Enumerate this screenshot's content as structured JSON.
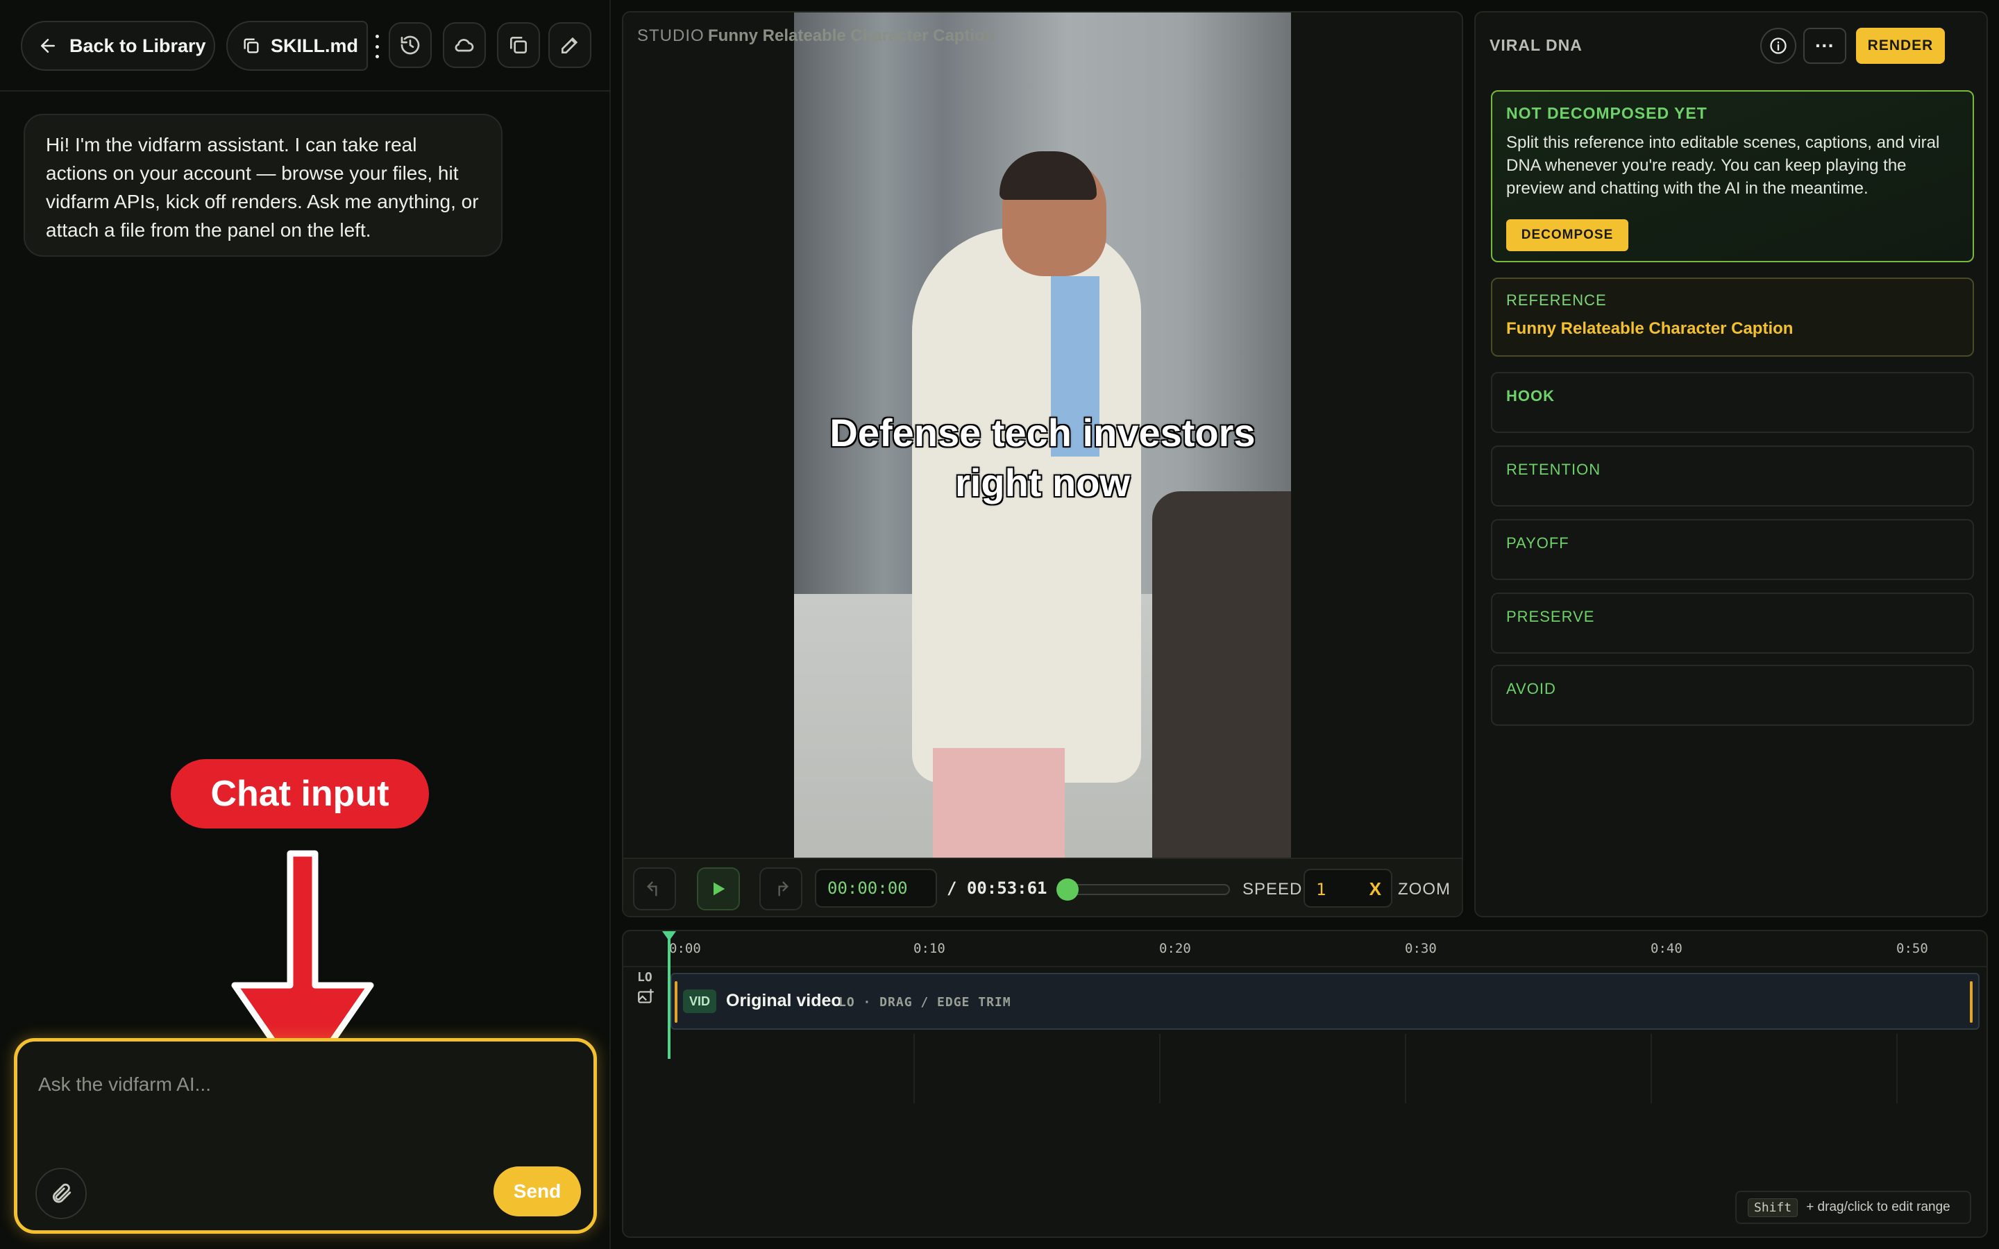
{
  "topbar": {
    "back_label": "Back to Library",
    "skill_label": "SKILL.md"
  },
  "chat": {
    "assistant_message": "Hi! I'm the vidfarm assistant. I can take real actions on your account — browse your files, hit vidfarm APIs, kick off renders. Ask me anything, or attach a file from the panel on the left.",
    "input_placeholder": "Ask the vidfarm AI...",
    "send_label": "Send"
  },
  "annotation": {
    "label": "Chat input",
    "color": "#e4202a"
  },
  "preview": {
    "studio_label": "STUDIO",
    "title": "Funny Relateable Character Caption",
    "caption_line1": "Defense tech investors",
    "caption_line2": "right now",
    "time_current": "00:00:00",
    "time_separator": "/",
    "time_total": "00:53:61",
    "speed_label": "SPEED",
    "speed_value": "1",
    "speed_suffix": "X",
    "zoom_label": "ZOOM",
    "scrub_position": 0
  },
  "viral_dna": {
    "title": "VIRAL DNA",
    "render_label": "RENDER",
    "more_label": "···",
    "not_decomposed": {
      "title": "NOT DECOMPOSED YET",
      "body": "Split this reference into editable scenes, captions, and viral DNA whenever you're ready. You can keep playing the preview and chatting with the AI in the meantime.",
      "button": "DECOMPOSE"
    },
    "reference": {
      "label": "REFERENCE",
      "title": "Funny Relateable Character Caption"
    },
    "sections": [
      "HOOK",
      "RETENTION",
      "PAYOFF",
      "PRESERVE",
      "AVOID"
    ]
  },
  "timeline": {
    "ticks": [
      "0:00",
      "0:10",
      "0:20",
      "0:30",
      "0:40",
      "0:50"
    ],
    "lane_label": "LO",
    "track": {
      "badge": "VID",
      "name": "Original video",
      "hint": "LO · DRAG / EDGE TRIM"
    },
    "shift_key": "Shift",
    "shift_hint": "+ drag/click to edit range"
  },
  "colors": {
    "accent_yellow": "#f3c12f",
    "accent_green": "#6fd16a"
  }
}
